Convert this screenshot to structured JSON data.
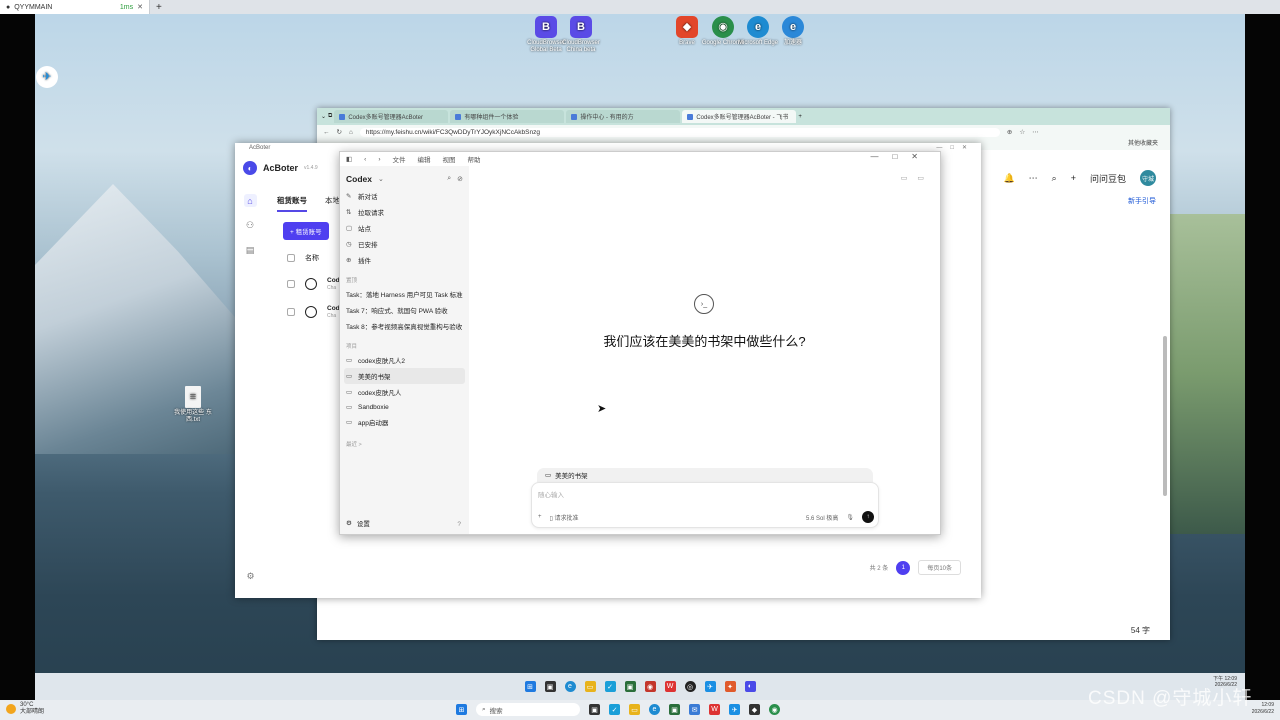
{
  "host": {
    "tab_title": "QYYMMAIN",
    "tab_ping": "1ms",
    "new_tab": "+"
  },
  "desktop": {
    "icons": [
      {
        "label": "CloudBrowser Global Beta",
        "color": "#5a4be6",
        "glyph": "B"
      },
      {
        "label": "CloudBrowser China beta",
        "color": "#5a4be6",
        "glyph": "B"
      },
      {
        "label": "Brave",
        "color": "#e2462a",
        "glyph": "◆"
      },
      {
        "label": "Google Chrome",
        "color": "#2a8f4b",
        "glyph": "◉"
      },
      {
        "label": "Microsoft Edge",
        "color": "#1e8bd1",
        "glyph": "e"
      },
      {
        "label": "加速器",
        "color": "#2b88d8",
        "glyph": "e"
      }
    ],
    "file_label": "我使用这些 东西.txt"
  },
  "browser": {
    "tabs": [
      "Codex多账号管理器AcBoter",
      "有哪种组件一个体验",
      "操作中心 - 有用的方",
      "Codex多账号管理器AcBoter - 飞书"
    ],
    "url": "https://my.feishu.cn/wiki/FC3QwDDyTrYJOykXjNCcAkbSnzg",
    "favorites": "其他收藏夹",
    "user_badge": "守城",
    "ask_label": "问问豆包",
    "guide_label": "新手引导",
    "word_count": "54 字"
  },
  "acboter": {
    "titlebar": "AcBoter",
    "brand": "AcBoter",
    "version": "v1.4.9",
    "tabs": [
      "租赁账号",
      "本地"
    ],
    "add_button": "+ 租赁账号",
    "col_name": "名称",
    "rows": [
      {
        "name": "Cod",
        "sub": "Cha"
      },
      {
        "name": "Cod",
        "sub": "Cha"
      }
    ],
    "pagination": {
      "total": "共 2 条",
      "page": "1",
      "per_page": "每页10条"
    }
  },
  "codex": {
    "menu": [
      "文件",
      "编辑",
      "视图",
      "帮助"
    ],
    "title": "Codex",
    "nav": [
      {
        "icon": "✎",
        "label": "新对话"
      },
      {
        "icon": "⇅",
        "label": "拉取请求"
      },
      {
        "icon": "▢",
        "label": "站点"
      },
      {
        "icon": "◷",
        "label": "已安排"
      },
      {
        "icon": "⊕",
        "label": "插件"
      }
    ],
    "section_pinned": "置顶",
    "tasks": [
      "Task：落地 Harness 用户可见 Task 标准",
      "Task 7：响应式、就国句 PWA 验收",
      "Task 8：参考视频高保真视觉重构与验收"
    ],
    "section_projects": "项目",
    "projects": [
      "codex皮肤凡人2",
      "美美的书架",
      "codex皮肤凡人",
      "Sandboxie",
      "app启动器"
    ],
    "recent": "最近 >",
    "settings": "设置",
    "question": "我们应该在美美的书架中做些什么?",
    "project_chip": "美美的书架",
    "input_placeholder": "随心输入",
    "tool_local": "请求批准",
    "model": "5.6 Sol  极高"
  },
  "taskbar": {
    "search": "搜索",
    "weather_temp": "30°C",
    "weather_desc": "大部晴朗",
    "remote_time": "下午 12:09",
    "remote_date": "2026/6/22",
    "host_time": "12:09",
    "host_date": "2026/6/22"
  },
  "watermark": "CSDN @守城小轩"
}
